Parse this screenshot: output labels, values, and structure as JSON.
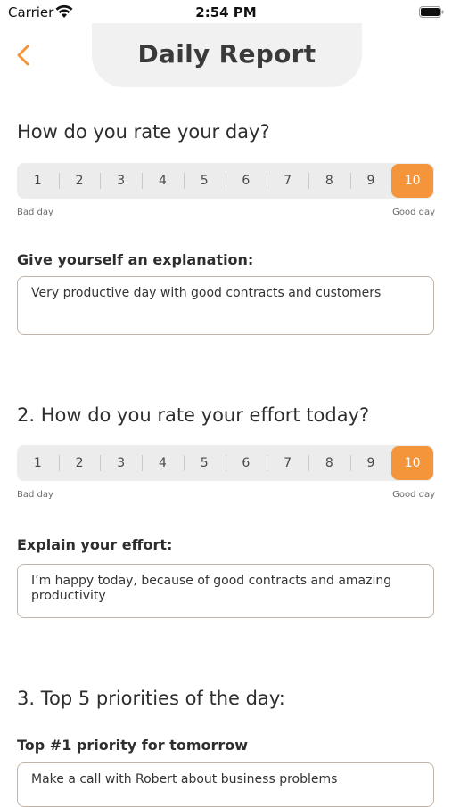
{
  "status": {
    "carrier": "Carrier",
    "time": "2:54 PM"
  },
  "header": {
    "title": "Daily Report",
    "back_icon": "chevron-left-icon",
    "accent": "#f4953b"
  },
  "q1": {
    "title": "How do you rate your day?",
    "options": [
      "1",
      "2",
      "3",
      "4",
      "5",
      "6",
      "7",
      "8",
      "9",
      "10"
    ],
    "selected": "10",
    "scale_low": "Bad day",
    "scale_high": "Good day",
    "explain_label": "Give yourself an explanation:",
    "explain_value": "Very productive day with good contracts and customers"
  },
  "q2": {
    "title": "2. How do you rate your effort today?",
    "options": [
      "1",
      "2",
      "3",
      "4",
      "5",
      "6",
      "7",
      "8",
      "9",
      "10"
    ],
    "selected": "10",
    "scale_low": "Bad day",
    "scale_high": "Good day",
    "explain_label": "Explain your effort:",
    "explain_value": "I’m happy today, because of good contracts and amazing productivity"
  },
  "q3": {
    "title": "3. Top 5 priorities of the day:",
    "priority_label": "Top #1 priority for tomorrow",
    "priority_value": "Make a call with Robert about business problems"
  }
}
